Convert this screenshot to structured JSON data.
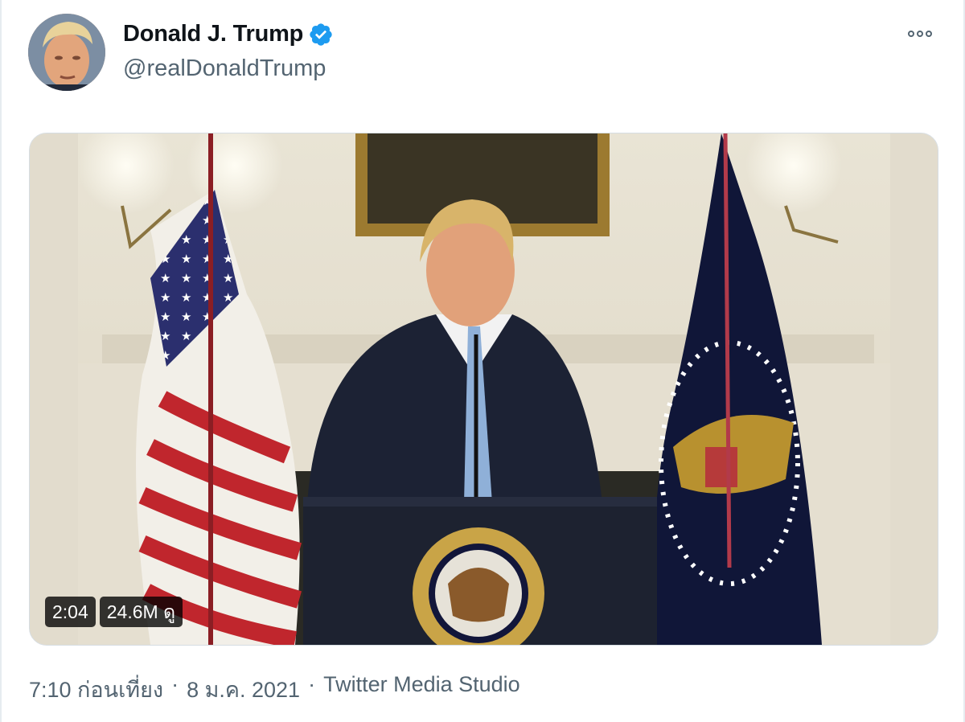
{
  "tweet": {
    "author": {
      "display_name": "Donald J. Trump",
      "handle": "@realDonaldTrump",
      "verified": true,
      "verified_color": "#1d9bf0"
    },
    "more_icon": "more-horizontal-icon",
    "media": {
      "type": "video",
      "duration": "2:04",
      "views": "24.6M ดู"
    },
    "time": "7:10 ก่อนเที่ยง",
    "separator": "·",
    "date": "8 ม.ค. 2021",
    "source": "Twitter Media Studio"
  }
}
